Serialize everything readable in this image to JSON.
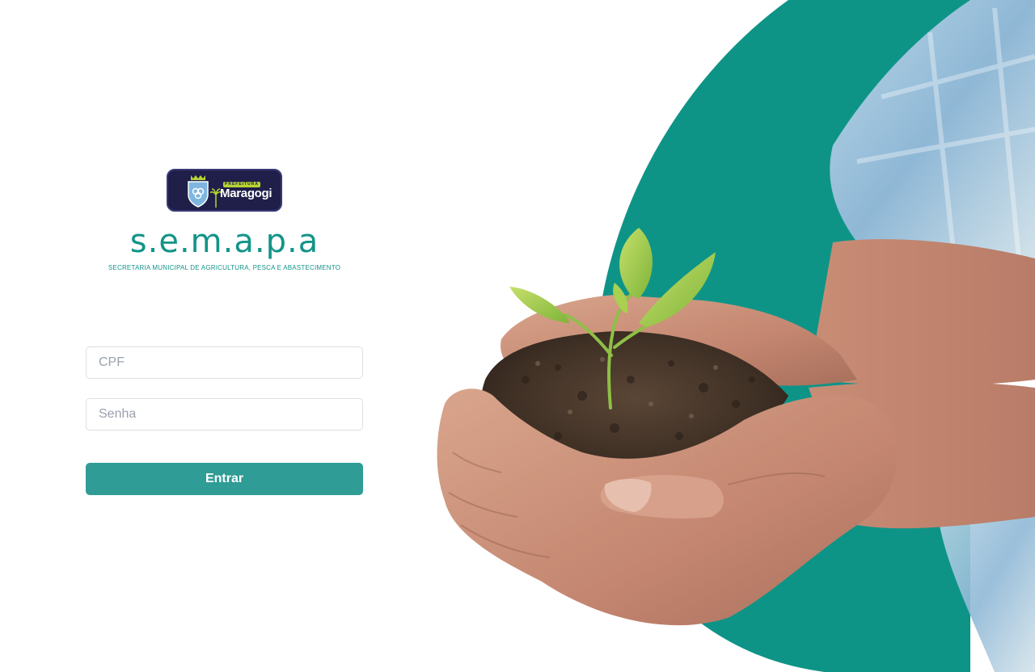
{
  "brand": {
    "logo_tag": "PREFEITURA",
    "logo_city": "Maragogi",
    "title": "s.e.m.a.p.a",
    "subtitle": "SECRETARIA MUNICIPAL DE AGRICULTURA, PESCA E ABASTECIMENTO"
  },
  "form": {
    "cpf_placeholder": "CPF",
    "senha_placeholder": "Senha",
    "submit_label": "Entrar"
  },
  "colors": {
    "accent": "#139488",
    "button": "#2f9c95",
    "logo_bg": "#1f1f4a",
    "logo_tag": "#b8d433",
    "hero_shape": "#0e9487"
  },
  "hero": {
    "icon": "hands-holding-seedling-photo"
  }
}
